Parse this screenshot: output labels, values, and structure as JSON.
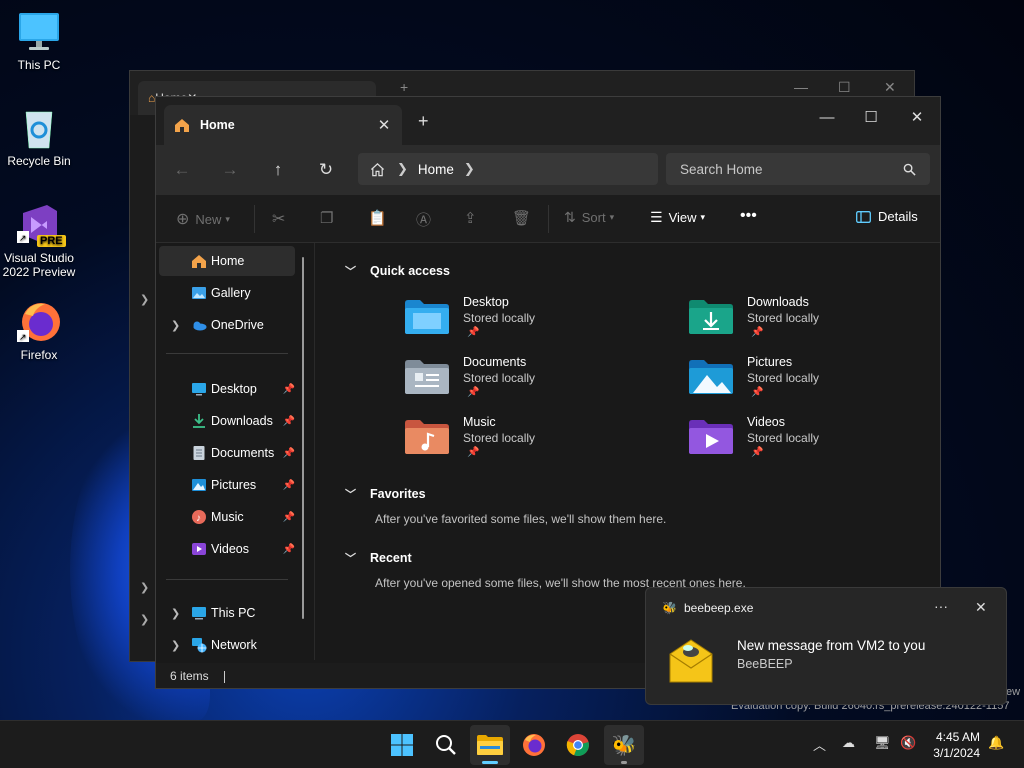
{
  "desktop": {
    "icons": [
      {
        "label": "This PC"
      },
      {
        "label": "Recycle Bin"
      },
      {
        "label": "Visual Studio 2022 Preview",
        "badge": "PRE"
      },
      {
        "label": "Firefox"
      }
    ]
  },
  "back_window": {
    "tab_title": "Home"
  },
  "window": {
    "tab_title": "Home",
    "address": {
      "segment": "Home"
    },
    "search_placeholder": "Search Home",
    "commands": {
      "new": "New",
      "sort": "Sort",
      "view": "View",
      "details": "Details"
    },
    "sidebar": {
      "top": [
        {
          "label": "Home",
          "selected": true,
          "icon": "home-icon"
        },
        {
          "label": "Gallery",
          "icon": "gallery-icon"
        },
        {
          "label": "OneDrive",
          "icon": "cloud-icon",
          "expandable": true
        }
      ],
      "pinned": [
        {
          "label": "Desktop",
          "icon": "desktop-icon"
        },
        {
          "label": "Downloads",
          "icon": "download-icon"
        },
        {
          "label": "Documents",
          "icon": "document-icon"
        },
        {
          "label": "Pictures",
          "icon": "picture-icon"
        },
        {
          "label": "Music",
          "icon": "music-icon"
        },
        {
          "label": "Videos",
          "icon": "video-icon"
        }
      ],
      "bottom": [
        {
          "label": "This PC",
          "icon": "computer-icon"
        },
        {
          "label": "Network",
          "icon": "network-icon"
        }
      ]
    },
    "sections": {
      "quick_access": {
        "title": "Quick access",
        "items": [
          {
            "name": "Desktop",
            "sub": "Stored locally"
          },
          {
            "name": "Downloads",
            "sub": "Stored locally"
          },
          {
            "name": "Documents",
            "sub": "Stored locally"
          },
          {
            "name": "Pictures",
            "sub": "Stored locally"
          },
          {
            "name": "Music",
            "sub": "Stored locally"
          },
          {
            "name": "Videos",
            "sub": "Stored locally"
          }
        ]
      },
      "favorites": {
        "title": "Favorites",
        "note": "After you've favorited some files, we'll show them here."
      },
      "recent": {
        "title": "Recent",
        "note": "After you've opened some files, we'll show the most recent ones here."
      }
    },
    "status": "6 items"
  },
  "toast": {
    "app": "beebeep.exe",
    "title": "New message from VM2 to you",
    "body": "BeeBEEP"
  },
  "watermark": {
    "line1": "Evaluation copy. Build 26040.rs_prerelease.240122-1157",
    "fragment": "ew"
  },
  "taskbar": {
    "time": "4:45 AM",
    "date": "3/1/2024"
  },
  "colors": {
    "accent": "#60cdff",
    "folder_blue": "#1e9bd7",
    "folder_teal": "#1aa58a"
  }
}
